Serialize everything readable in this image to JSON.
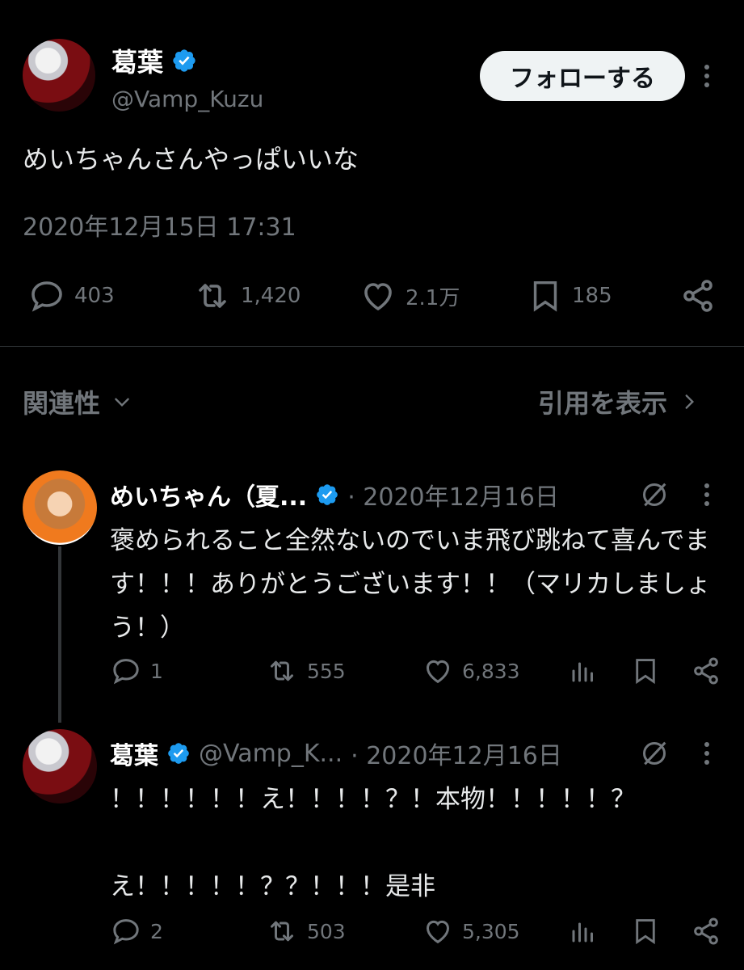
{
  "main_tweet": {
    "author_name": "葛葉",
    "author_handle": "@Vamp_Kuzu",
    "follow_label": "フォローする",
    "text": "めいちゃんさんやっぱいいな",
    "timestamp": "2020年12月15日 17:31",
    "actions": {
      "replies": "403",
      "retweets": "1,420",
      "likes": "2.1万",
      "bookmarks": "185"
    }
  },
  "sort_bar": {
    "sort_label": "関連性",
    "quotes_link": "引用を表示"
  },
  "replies": [
    {
      "author_name": "めいちゃん（夏...",
      "meta": "· 2020年12月16日",
      "text": "褒められること全然ないのでいま飛び跳ねて喜んでます！！！ありがとうございます！！（マリカしましょう！）",
      "actions": {
        "replies": "1",
        "retweets": "555",
        "likes": "6,833"
      }
    },
    {
      "author_name": "葛葉",
      "handle": "@Vamp_K...",
      "meta": "· 2020年12月16日",
      "text": "！！！！！！え！！！！？！本物！！！！！？\n\nえ！！！！！？？！！！是非",
      "actions": {
        "replies": "2",
        "retweets": "503",
        "likes": "5,305"
      }
    }
  ],
  "colors": {
    "background": "#000000",
    "text": "#e7e9ea",
    "muted": "#71767b",
    "verified": "#1d9bf0",
    "divider": "#2f3336"
  },
  "icons": [
    "verified-badge-icon",
    "more-dots-icon",
    "reply-icon",
    "retweet-icon",
    "like-icon",
    "bookmark-icon",
    "share-icon",
    "views-chart-icon",
    "chevron-down-icon",
    "chevron-right-icon",
    "grok-icon"
  ]
}
